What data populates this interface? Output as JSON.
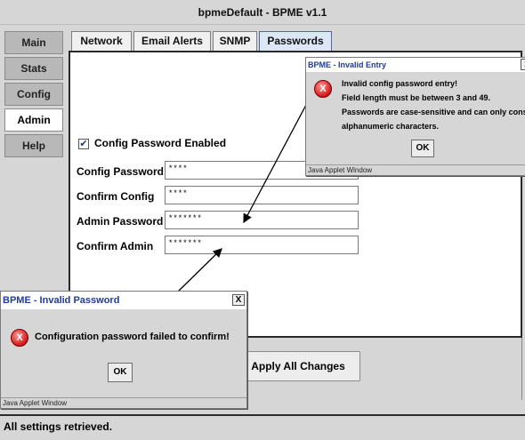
{
  "window": {
    "title": "bpmeDefault - BPME v1.1"
  },
  "nav": {
    "items": [
      {
        "label": "Main",
        "active": false
      },
      {
        "label": "Stats",
        "active": false
      },
      {
        "label": "Config",
        "active": false
      },
      {
        "label": "Admin",
        "active": true
      },
      {
        "label": "Help",
        "active": false
      }
    ]
  },
  "tabs": [
    {
      "label": "Network",
      "active": false
    },
    {
      "label": "Email Alerts",
      "active": false
    },
    {
      "label": "SNMP",
      "active": false
    },
    {
      "label": "Passwords",
      "active": true
    }
  ],
  "form": {
    "config_enabled_label": "Config Password Enabled",
    "config_enabled_checked": true,
    "checkmark": "✔",
    "fields": [
      {
        "label": "Config Password",
        "value": "****"
      },
      {
        "label": "Confirm Config",
        "value": "****"
      },
      {
        "label": "Admin Password",
        "value": "*******"
      },
      {
        "label": "Confirm Admin",
        "value": "*******"
      }
    ]
  },
  "apply_button": "Apply All Changes",
  "status_bar": "All settings retrieved.",
  "dialog_entry": {
    "title": "BPME - Invalid Entry",
    "close": "x",
    "icon": "X",
    "lines": [
      "Invalid config password entry!",
      "Field length must be between 3 and 49.",
      "Passwords are case-sensitive and can only consist of",
      "alphanumeric characters."
    ],
    "ok": "OK",
    "footer": "Java Applet Window"
  },
  "dialog_password": {
    "title": "BPME - Invalid Password",
    "close": "X",
    "icon": "X",
    "message": "Configuration password failed to confirm!",
    "ok": "OK",
    "footer": "Java Applet Window"
  },
  "colors": {
    "chrome": "#d6d6d6",
    "active_tab": "#dce6f6",
    "error_icon": "#d41616",
    "dialog_title_text": "#1f3aa0"
  }
}
